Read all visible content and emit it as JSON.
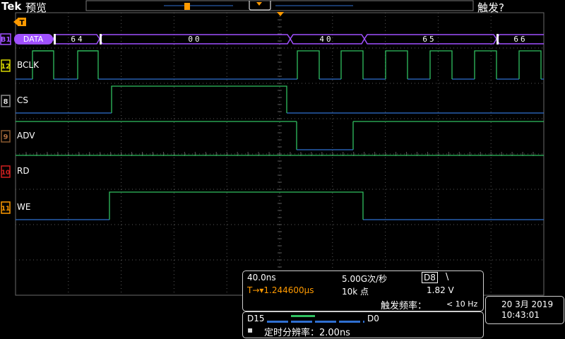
{
  "header": {
    "brand": "Tek",
    "mode": "预览",
    "trigger_status": "触发?"
  },
  "colors": {
    "grid": "#5a5a5a",
    "bus": "#a050ff",
    "channel_clock": "#30c060",
    "channel_low": "#2f6fd0",
    "trigger_marker": "#ff9a00",
    "bclk_label_border": "#d8d800",
    "cs_label_border": "#8a8a8a",
    "adv_label_border": "#8a5a30",
    "rd_label_border": "#d02020",
    "we_label_border": "#ff9a00"
  },
  "bus": {
    "marker": "B1",
    "label": "DATA",
    "segments": [
      {
        "value": "64"
      },
      {
        "value": "00"
      },
      {
        "value": "40"
      },
      {
        "value": "65"
      },
      {
        "value": "66"
      }
    ]
  },
  "channels": [
    {
      "marker": "12",
      "name": "BCLK"
    },
    {
      "marker": "8",
      "name": "CS"
    },
    {
      "marker": "9",
      "name": "ADV"
    },
    {
      "marker": "10",
      "name": "RD"
    },
    {
      "marker": "11",
      "name": "WE"
    }
  ],
  "trigger_marker": "T",
  "acquisition": {
    "horizontal_scale": "40.0ns",
    "sample_rate": "5.00G次/秒",
    "trigger_source": "D8",
    "trigger_slope": "\\",
    "trigger_position": "T→▾1.244600μs",
    "record_length": "10k 点",
    "trigger_level": "1.82 V",
    "trigger_freq_label": "触发频率：",
    "trigger_freq_value": "< 10 Hz"
  },
  "digital": {
    "high_label": "D15",
    "low_label": "D0",
    "timing_resolution": "定时分辨率：2.00ns"
  },
  "datetime": {
    "date": "20 3月 2019",
    "time": "10:43:01"
  }
}
